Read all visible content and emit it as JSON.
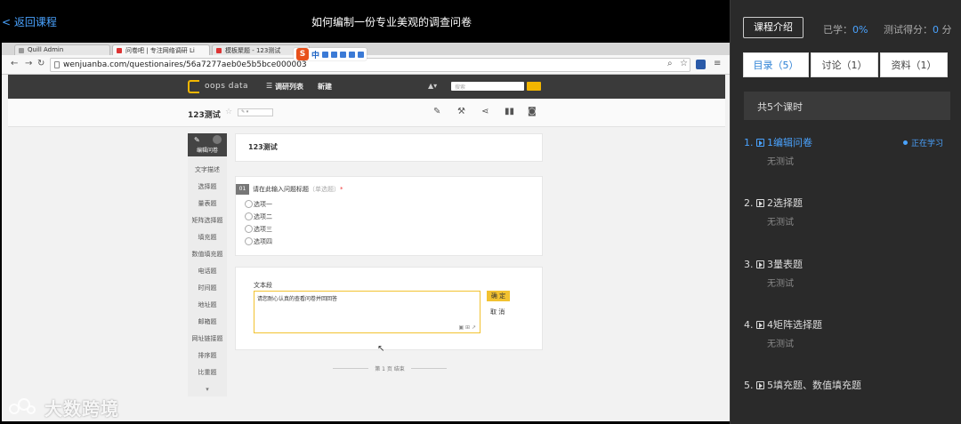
{
  "topbar": {
    "back_label": "< 返回课程",
    "title": "如何编制一份专业美观的调查问卷"
  },
  "browser": {
    "tabs": [
      "Quill Admin",
      "问卷吧 | 专注网络调研 Li",
      "模板聚题 - 123测试"
    ],
    "url": "wenjuanba.com/questionaires/56a7277aeb0e5b5bce000003"
  },
  "site": {
    "logo": "oops data",
    "nav_survey_list": "调研列表",
    "nav_new": "新建",
    "search_placeholder": "搜索"
  },
  "editor": {
    "survey_name": "123测试",
    "edit_tab": "编辑问卷",
    "left_nav": [
      "文字描述",
      "选择题",
      "量表题",
      "矩阵选择题",
      "填充题",
      "数值填充题",
      "电话题",
      "时间题",
      "地址题",
      "邮箱题",
      "网址链接题",
      "排序题",
      "比重题"
    ],
    "title_card": "123测试",
    "question": {
      "num": "01",
      "title": "请在此输入问题标题",
      "type": "（单选题）",
      "required_mark": "*",
      "options": [
        "选项一",
        "选项二",
        "选项三",
        "选项四"
      ]
    },
    "text_block": {
      "label": "文本段",
      "content": "请您耐心认真的查看问卷并回回答",
      "confirm": "确 定",
      "cancel": "取 消"
    },
    "page_end": "第 1 页 结束"
  },
  "watermark": "大数跨境",
  "panel": {
    "intro_button": "课程介绍",
    "learned_label": "已学：",
    "learned_value": "0%",
    "score_label": "测试得分：",
    "score_value": "0",
    "score_unit": " 分",
    "tabs": [
      "目录（5）",
      "讨论（1）",
      "资料（1）"
    ],
    "lessons_header": "共5个课时",
    "studying_label": "正在学习",
    "lessons": [
      {
        "title": "1.  1编辑问卷",
        "sub": "无测试"
      },
      {
        "title": "2.  2选择题",
        "sub": "无测试"
      },
      {
        "title": "3.  3量表题",
        "sub": "无测试"
      },
      {
        "title": "4.  4矩阵选择题",
        "sub": "无测试"
      },
      {
        "title": "5.  5填充题、数值填充题",
        "sub": ""
      }
    ]
  },
  "colors": {
    "accent_blue": "#4aa3ff",
    "brand_yellow": "#f2c230",
    "panel_bg": "#2a2a2a"
  }
}
